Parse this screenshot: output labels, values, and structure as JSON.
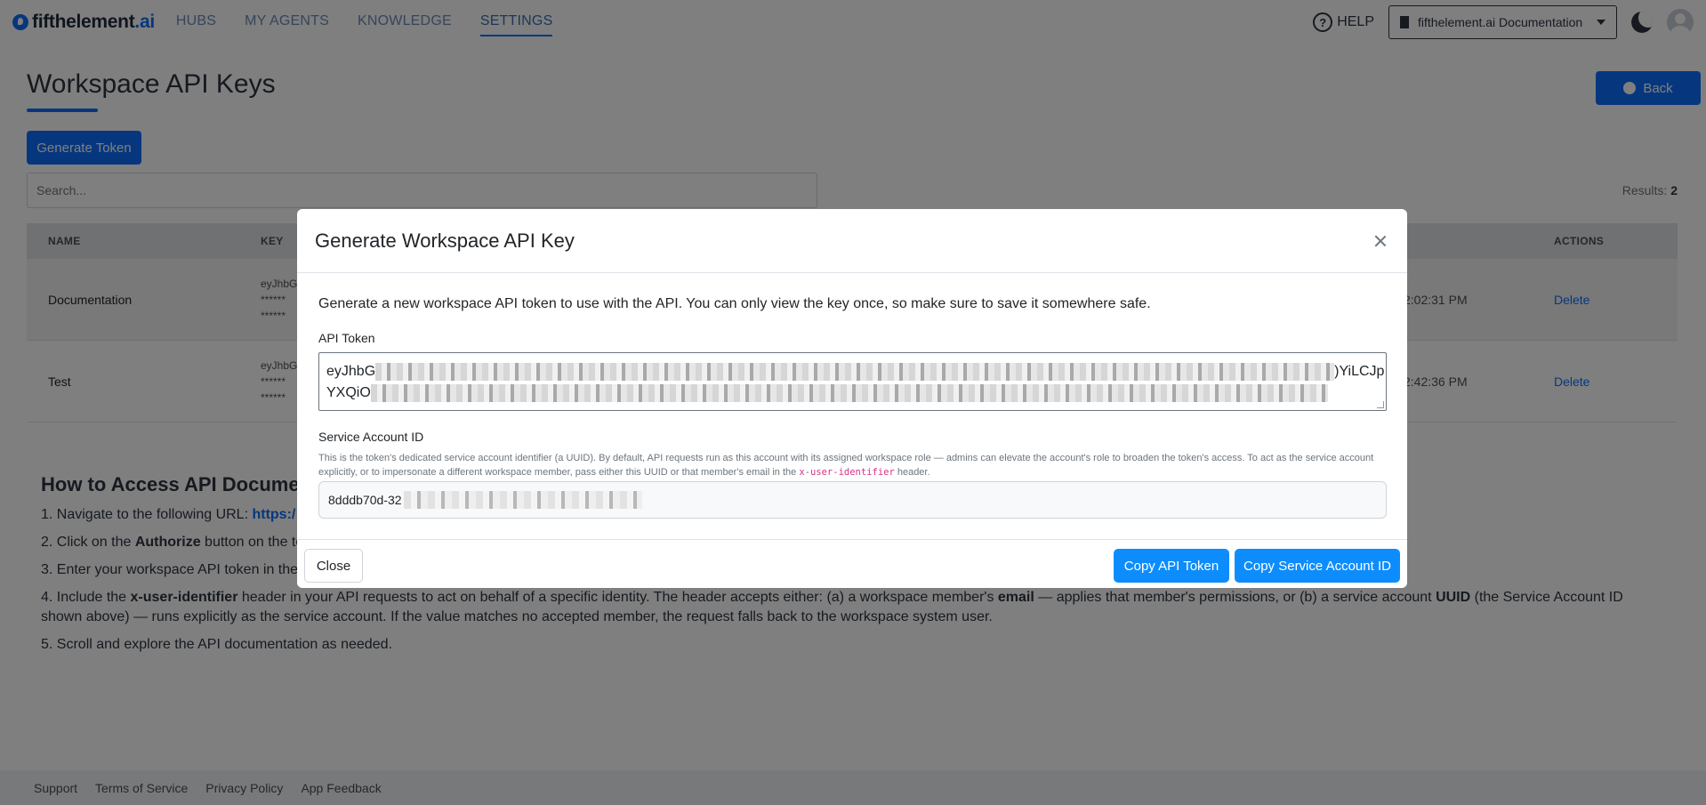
{
  "nav": {
    "brand_main": "fifthelement",
    "brand_suffix": ".ai",
    "links": [
      "HUBS",
      "MY AGENTS",
      "KNOWLEDGE",
      "SETTINGS"
    ],
    "active_link": "SETTINGS",
    "help_label": "HELP",
    "workspace_selected": "fifthelement.ai Documentation"
  },
  "page": {
    "title": "Workspace API Keys",
    "back_label": "Back",
    "generate_label": "Generate Token",
    "search_placeholder": "Search...",
    "results_label": "Results:",
    "results_count": "2"
  },
  "table": {
    "headers": {
      "name": "NAME",
      "key": "KEY",
      "actions": "ACTIONS"
    },
    "rows": [
      {
        "name": "Documentation",
        "key_prefix": "eyJhbG",
        "key_masked_1": "******",
        "key_masked_2": "******",
        "created_suffix": "2:02:31 PM",
        "action": "Delete"
      },
      {
        "name": "Test",
        "key_prefix": "eyJhbG",
        "key_masked_1": "******",
        "key_masked_2": "******",
        "created_suffix": "2:42:36 PM",
        "action": "Delete"
      }
    ]
  },
  "howto": {
    "title": "How to Access API Docume",
    "step1_text": "1. Navigate to the following URL: ",
    "step1_link": "https:/",
    "step2_pre": "2. Click on the ",
    "step2_bold": "Authorize",
    "step2_post": " button on the to",
    "step3": "3. Enter your workspace API token in the",
    "step4_pre": "4. Include the ",
    "step4_bold1": "x-user-identifier",
    "step4_mid1": " header in your API requests to act on behalf of a specific identity. The header accepts either: (a) a workspace member's ",
    "step4_bold2": "email",
    "step4_mid2": " — applies that member's permissions, or (b) a service account ",
    "step4_bold3": "UUID",
    "step4_post": " (the Service Account ID shown above) — runs explicitly as the service account. If the value matches no accepted member, the request falls back to the workspace system user.",
    "step5": "5. Scroll and explore the API documentation as needed."
  },
  "footer": {
    "links": [
      "Support",
      "Terms of Service",
      "Privacy Policy",
      "App Feedback"
    ]
  },
  "modal": {
    "title": "Generate Workspace API Key",
    "intro": "Generate a new workspace API token to use with the API. You can only view the key once, so make sure to save it somewhere safe.",
    "token_label": "API Token",
    "token_line1_start": "eyJhbG",
    "token_line1_end": ")YiLCJp",
    "token_line2_start": "YXQiO",
    "service_label": "Service Account ID",
    "service_help_pre": "This is the token's dedicated service account identifier (a UUID). By default, API requests run as this account with its assigned workspace role — admins can elevate the account's role to broaden the token's access. To act as the service account explicitly, or to impersonate a different workspace member, pass either this UUID or that member's email in the ",
    "service_help_code": "x-user-identifier",
    "service_help_post": " header.",
    "service_id_start": "8dddb70d-32",
    "close_label": "Close",
    "copy_token_label": "Copy API Token",
    "copy_service_label": "Copy Service Account ID"
  },
  "colors": {
    "accent": "#0d6efd",
    "modal_button": "#0d8dfd",
    "help_code": "#d63384"
  }
}
